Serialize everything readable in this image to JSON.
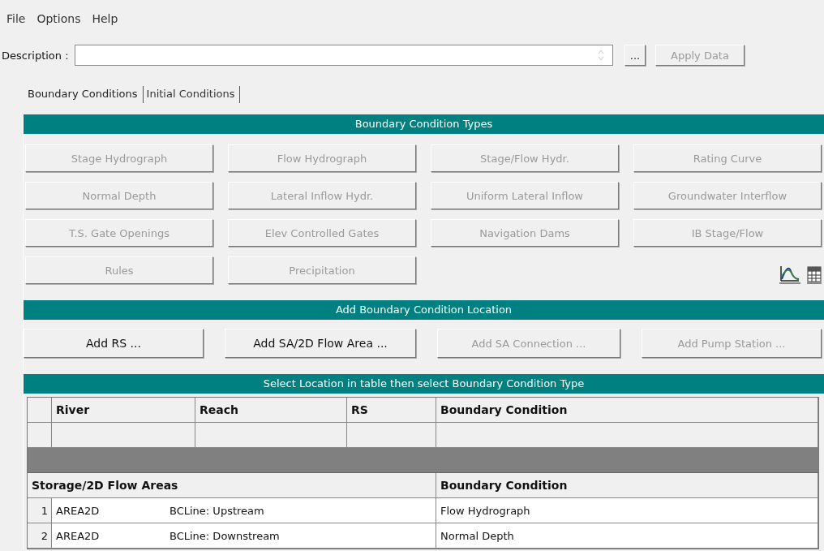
{
  "menu": [
    "File",
    "Options",
    "Help"
  ],
  "description": {
    "label": "Description :",
    "browse_button": "...",
    "apply_button": {
      "label": "Apply Data",
      "disabled": true
    }
  },
  "tabs": [
    {
      "label": "Boundary Conditions",
      "selected": true
    },
    {
      "label": "Initial Conditions",
      "selected": false
    }
  ],
  "bc_types": {
    "title": "Boundary Condition Types",
    "buttons": [
      {
        "label": "Stage Hydrograph",
        "disabled": true
      },
      {
        "label": "Flow Hydrograph",
        "disabled": true
      },
      {
        "label": "Stage/Flow Hydr.",
        "disabled": true
      },
      {
        "label": "Rating Curve",
        "disabled": true
      },
      {
        "label": "Normal Depth",
        "disabled": true
      },
      {
        "label": "Lateral Inflow Hydr.",
        "disabled": true
      },
      {
        "label": "Uniform Lateral Inflow",
        "disabled": true
      },
      {
        "label": "Groundwater Interflow",
        "disabled": true
      },
      {
        "label": "T.S. Gate Openings",
        "disabled": true
      },
      {
        "label": "Elev Controlled Gates",
        "disabled": true
      },
      {
        "label": "Navigation Dams",
        "disabled": true
      },
      {
        "label": "IB Stage/Flow",
        "disabled": true
      },
      {
        "label": "Rules",
        "disabled": true
      },
      {
        "label": "Precipitation",
        "disabled": true
      }
    ]
  },
  "add_location": {
    "title": "Add Boundary Condition Location",
    "buttons": [
      {
        "label": "Add RS ...",
        "disabled": false
      },
      {
        "label": "Add SA/2D Flow Area ...",
        "disabled": false
      },
      {
        "label": "Add SA Connection ...",
        "disabled": true
      },
      {
        "label": "Add Pump Station ...",
        "disabled": true
      }
    ]
  },
  "table": {
    "title": "Select Location in table then select Boundary Condition Type",
    "river_columns": [
      "River",
      "Reach",
      "RS",
      "Boundary Condition"
    ],
    "area_columns": [
      "Storage/2D Flow Areas",
      "Boundary Condition"
    ],
    "area_rows": [
      {
        "index": "1",
        "area": "AREA2D",
        "line": "BCLine: Upstream",
        "condition": "Flow Hydrograph"
      },
      {
        "index": "2",
        "area": "AREA2D",
        "line": "BCLine: Downstream",
        "condition": "Normal Depth"
      }
    ]
  }
}
